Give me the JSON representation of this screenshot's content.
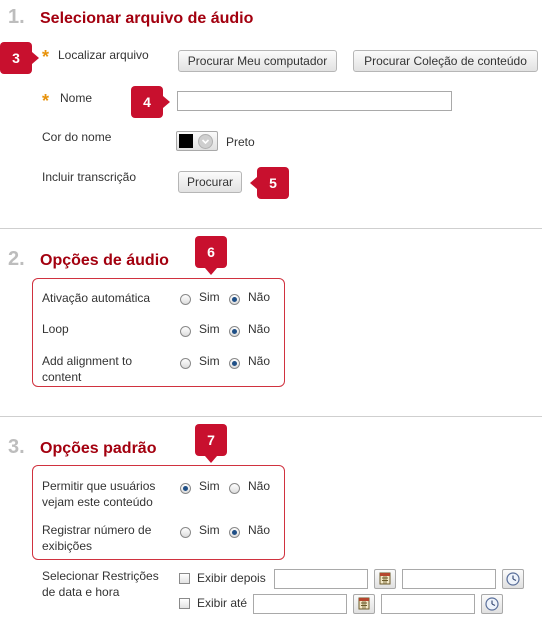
{
  "section1": {
    "number": "1.",
    "title": "Selecionar arquivo de áudio",
    "required_star": "*",
    "find_file_label": "Localizar arquivo",
    "browse_computer": "Procurar Meu computador",
    "browse_collection": "Procurar Coleção de conteúdo",
    "name_label": "Nome",
    "name_value": "",
    "color_label": "Cor do nome",
    "color_value": "Preto",
    "color_swatch": "#000000",
    "transcript_label": "Incluir transcrição",
    "browse": "Procurar"
  },
  "section2": {
    "number": "2.",
    "title": "Opções de áudio",
    "rows": [
      {
        "label_line1": "Ativação automática",
        "label_line2": "",
        "yes": "Sim",
        "no": "Não",
        "selected": "no"
      },
      {
        "label_line1": "Loop",
        "label_line2": "",
        "yes": "Sim",
        "no": "Não",
        "selected": "no"
      },
      {
        "label_line1": "Add alignment to",
        "label_line2": "content",
        "yes": "Sim",
        "no": "Não",
        "selected": "no"
      }
    ]
  },
  "section3": {
    "number": "3.",
    "title": "Opções padrão",
    "rows": [
      {
        "label_line1": "Permitir que usuários",
        "label_line2": "vejam este conteúdo",
        "yes": "Sim",
        "no": "Não",
        "selected": "yes"
      },
      {
        "label_line1": "Registrar número de",
        "label_line2": "exibições",
        "yes": "Sim",
        "no": "Não",
        "selected": "no"
      }
    ],
    "date_label_line1": "Selecionar Restrições",
    "date_label_line2": "de data e hora",
    "display_after": "Exibir depois",
    "display_until": "Exibir até"
  },
  "callouts": {
    "c3": "3",
    "c4": "4",
    "c5": "5",
    "c6": "6",
    "c7": "7"
  },
  "colors": {
    "accent": "#a3000f",
    "callout": "#c8102e",
    "star": "#e8930c"
  },
  "icons": [
    "calendar-icon",
    "clock-icon",
    "chevron-down-icon"
  ]
}
